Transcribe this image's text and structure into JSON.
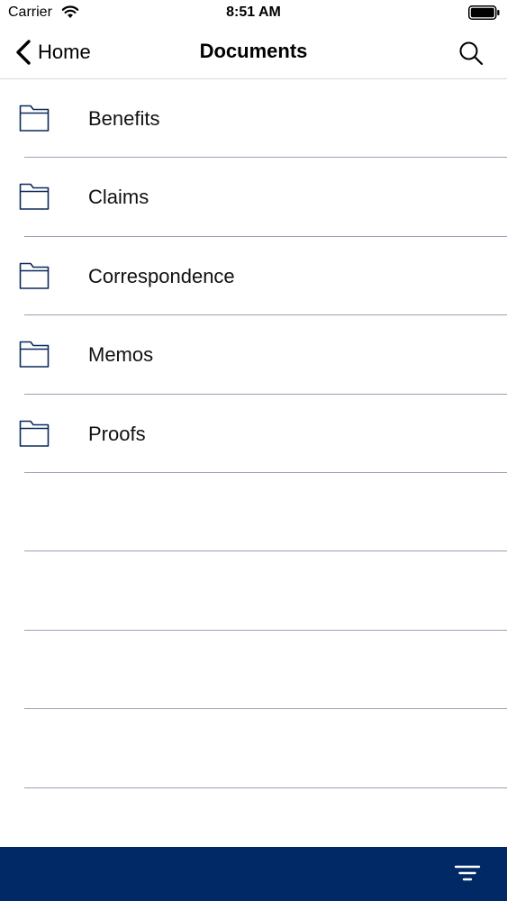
{
  "status_bar": {
    "carrier": "Carrier",
    "time": "8:51 AM",
    "icons": [
      "wifi-icon",
      "battery-icon"
    ]
  },
  "nav_bar": {
    "back_label": "Home",
    "title": "Documents",
    "icons": [
      "chevron-left-icon",
      "search-icon"
    ]
  },
  "folders": [
    {
      "label": "Benefits",
      "icon": "folder-icon"
    },
    {
      "label": "Claims",
      "icon": "folder-icon"
    },
    {
      "label": "Correspondence",
      "icon": "folder-icon"
    },
    {
      "label": "Memos",
      "icon": "folder-icon"
    },
    {
      "label": "Proofs",
      "icon": "folder-icon"
    }
  ],
  "bottom_bar": {
    "icon": "filter-icon"
  },
  "colors": {
    "accent": "#002966",
    "icon_stroke": "#0a2a5c",
    "separator": "#9aa0b5"
  }
}
